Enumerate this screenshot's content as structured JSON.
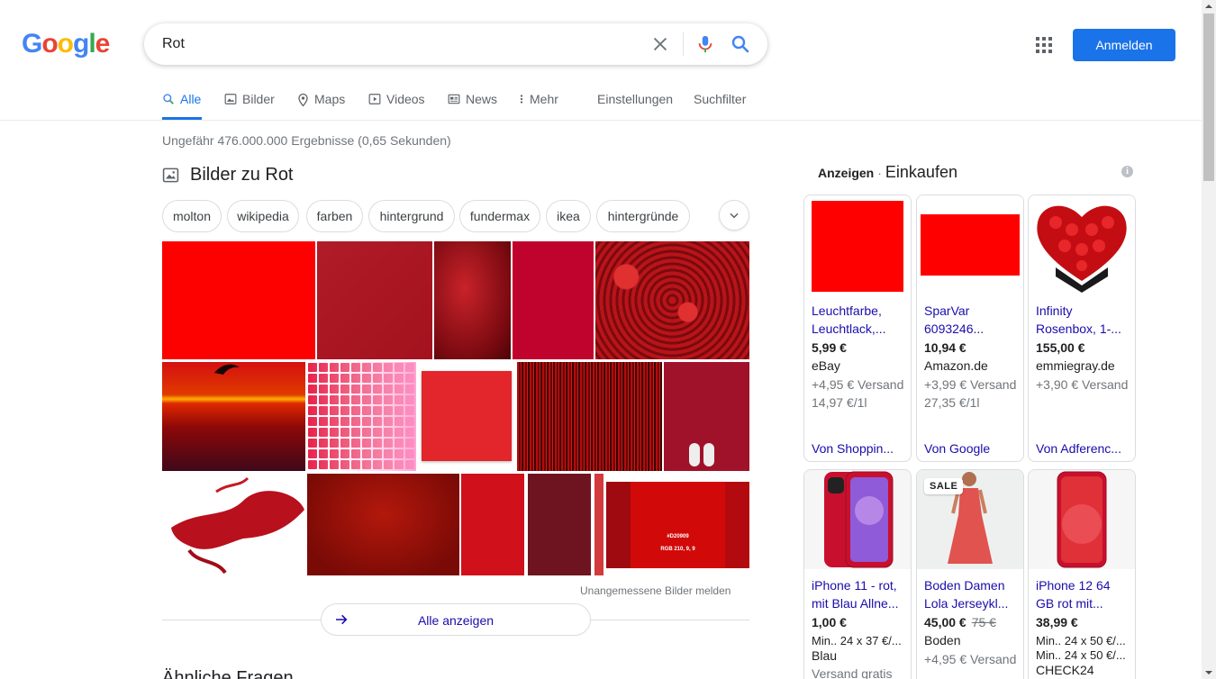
{
  "logo": {
    "text": "Google",
    "colors": [
      "#4285f4",
      "#ea4335",
      "#fbbc05",
      "#4285f4",
      "#34a853",
      "#ea4335"
    ]
  },
  "search": {
    "value": "Rot"
  },
  "header": {
    "signin_label": "Anmelden"
  },
  "tabs": [
    {
      "label": "Alle",
      "icon": "search-icon"
    },
    {
      "label": "Bilder",
      "icon": "image-icon"
    },
    {
      "label": "Maps",
      "icon": "map-pin-icon"
    },
    {
      "label": "Videos",
      "icon": "video-icon"
    },
    {
      "label": "News",
      "icon": "news-icon"
    },
    {
      "label": "Mehr",
      "icon": "more-vert-icon"
    },
    {
      "label": "Einstellungen"
    },
    {
      "label": "Suchfilter"
    }
  ],
  "stats": "Ungefähr 476.000.000 Ergebnisse (0,65 Sekunden)",
  "images": {
    "title": "Bilder zu Rot",
    "chips": [
      "molton",
      "wikipedia",
      "farben",
      "hintergrund",
      "fundermax",
      "ikea",
      "hintergründe"
    ],
    "swatch_label_1": "#D20909",
    "swatch_label_2": "RGB 210, 9, 9",
    "report": "Unangemessene Bilder melden",
    "show_all": "Alle anzeigen"
  },
  "next_heading": "Ähnliche Fragen",
  "shopping": {
    "ads_label": "Anzeigen",
    "separator": "·",
    "title": "Einkaufen",
    "info": "i",
    "row1": [
      {
        "title1": "Leuchtfarbe,",
        "title2": "Leuchtlack,...",
        "price": "5,99 €",
        "seller": "eBay",
        "shipping": "+4,95 € Versand",
        "unit": "14,97 €/1l",
        "from": "Von Shoppin..."
      },
      {
        "title1": "SparVar",
        "title2": "6093246...",
        "price": "10,94 €",
        "seller": "Amazon.de",
        "shipping": "+3,99 € Versand",
        "unit": "27,35 €/1l",
        "from": "Von Google"
      },
      {
        "title1": "Infinity",
        "title2": "Rosenbox, 1-...",
        "price": "155,00 €",
        "seller": "emmiegray.de",
        "shipping": "+3,90 € Versand",
        "from": "Von Adferenc..."
      }
    ],
    "row2": [
      {
        "title1": "iPhone 11 - rot,",
        "title2": "mit Blau Allne...",
        "price": "1,00 €",
        "detail": "Min.. 24 x 37 €/...",
        "seller": "Blau",
        "shipping": "Versand gratis"
      },
      {
        "badge": "SALE",
        "title1": "Boden Damen",
        "title2": "Lola Jerseykl...",
        "price": "45,00 €",
        "old_price": "75 €",
        "seller": "Boden",
        "shipping": "+4,95 € Versand"
      },
      {
        "title1": "iPhone 12 64",
        "title2": "GB rot mit...",
        "price": "38,99 €",
        "detail": "Min.. 24 x 50 €/...",
        "detail2": "Min.. 24 x 50 €/...",
        "seller": "CHECK24"
      }
    ]
  }
}
